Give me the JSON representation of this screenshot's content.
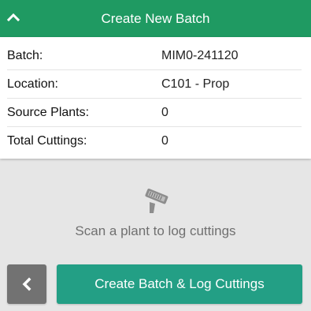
{
  "header": {
    "title": "Create New Batch",
    "collapse_icon": "chevron-up-icon"
  },
  "details": [
    {
      "label": "Batch:",
      "value": "MIM0-241120"
    },
    {
      "label": "Location:",
      "value": "C101 - Prop"
    },
    {
      "label": "Source Plants:",
      "value": "0"
    },
    {
      "label": "Total Cuttings:",
      "value": "0"
    }
  ],
  "empty_state": {
    "icon": "barcode-scanner-icon",
    "message": "Scan a plant to log cuttings"
  },
  "footer": {
    "back_icon": "chevron-left-icon",
    "primary_label": "Create Batch & Log Cuttings"
  },
  "colors": {
    "header": "#1f9a62",
    "primary_button": "#239f85",
    "back_button": "#727272",
    "background": "#e6e6e6"
  }
}
